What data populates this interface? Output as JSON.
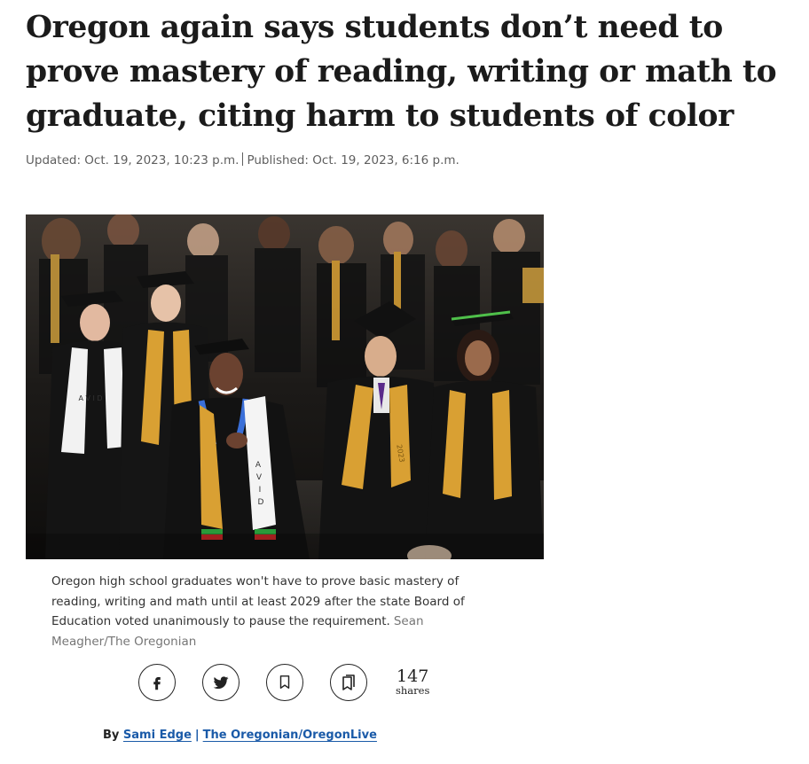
{
  "article": {
    "headline": "Oregon again says students don’t need to prove mastery of reading, writing or math to graduate, citing harm to students of color",
    "updated": "Updated: Oct. 19, 2023, 10:23 p.m.",
    "published": "Published: Oct. 19, 2023, 6:16 p.m."
  },
  "photo": {
    "gown_text": [
      "A",
      "V",
      "I",
      "D"
    ],
    "stole_text": "2023"
  },
  "caption": {
    "text": "Oregon high school graduates won't have to prove basic mastery of reading, writing and math until at least 2029 after the state Board of Education voted unanimously to pause the requirement.",
    "credit": "Sean Meagher/The Oregonian"
  },
  "share": {
    "buttons": [
      {
        "icon": "facebook-icon"
      },
      {
        "icon": "twitter-icon"
      },
      {
        "icon": "bookmark-icon"
      },
      {
        "icon": "saved-list-icon"
      }
    ],
    "count": "147",
    "count_label": "shares"
  },
  "byline": {
    "prefix": "By",
    "author": "Sami Edge",
    "separator": "|",
    "outlet": "The Oregonian/OregonLive"
  },
  "colors": {
    "link": "#1a5aa8",
    "text": "#222222",
    "meta": "#5f5f5f",
    "gold_stole": "#d9a033"
  }
}
